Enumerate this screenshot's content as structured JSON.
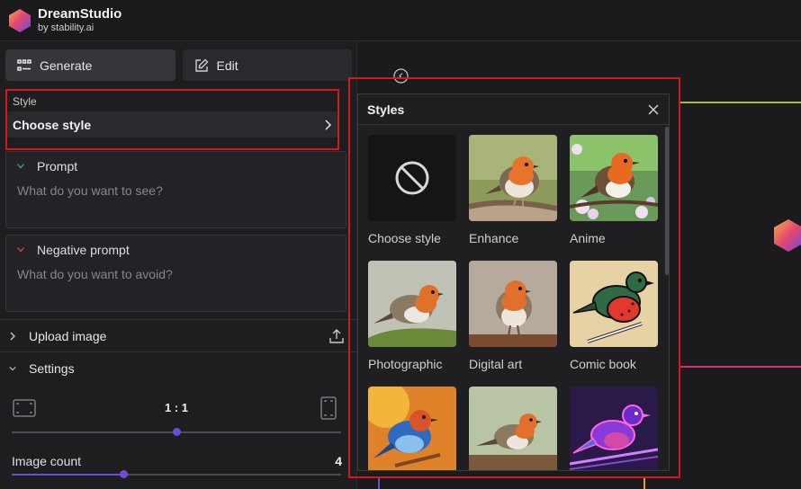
{
  "brand": {
    "title": "DreamStudio",
    "subtitle": "by stability.ai"
  },
  "tabs": [
    {
      "label": "Generate",
      "icon": "grid-icon",
      "active": true
    },
    {
      "label": "Edit",
      "icon": "edit-icon",
      "active": false
    }
  ],
  "style": {
    "label": "Style",
    "value": "Choose style"
  },
  "prompt": {
    "label": "Prompt",
    "placeholder": "What do you want to see?"
  },
  "negative_prompt": {
    "label": "Negative prompt",
    "placeholder": "What do you want to avoid?"
  },
  "upload": {
    "label": "Upload image"
  },
  "settings": {
    "label": "Settings",
    "aspect_ratio": "1 : 1",
    "aspect_slider_fraction": 0.5,
    "image_count_label": "Image count",
    "image_count_value": "4",
    "image_count_fraction": 0.34
  },
  "styles_popup": {
    "title": "Styles",
    "items": [
      {
        "label": "Choose style",
        "icon": "none-icon"
      },
      {
        "label": "Enhance"
      },
      {
        "label": "Anime"
      },
      {
        "label": "Photographic"
      },
      {
        "label": "Digital art"
      },
      {
        "label": "Comic book"
      },
      {
        "label": ""
      },
      {
        "label": ""
      },
      {
        "label": ""
      }
    ]
  },
  "colors": {
    "accent": "#6e4cd6",
    "highlight": "#d21a1a",
    "yellow_line": "#9fbf3a",
    "pink_line": "#d72a72"
  }
}
